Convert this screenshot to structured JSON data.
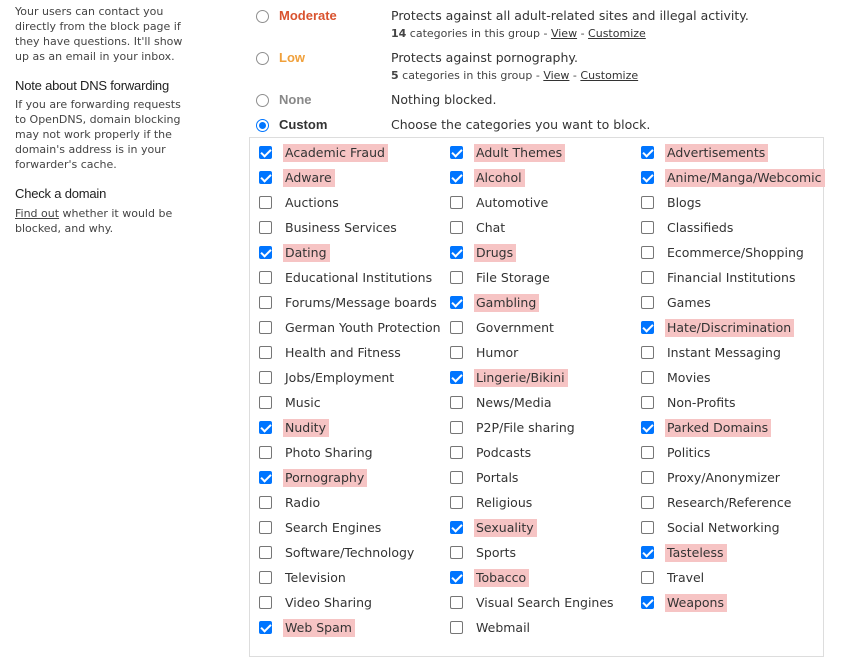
{
  "sidebar": {
    "intro": "Your users can contact you directly from the block page if they have questions. It'll show up as an email in your inbox.",
    "dns_heading": "Note about DNS forwarding",
    "dns_text": "If you are forwarding requests to OpenDNS, domain blocking may not work properly if the domain's address is in your forwarder's cache.",
    "check_heading": "Check a domain",
    "check_link": "Find out",
    "check_text": " whether it would be blocked, and why."
  },
  "levels": [
    {
      "name": "Moderate",
      "color": "#d9532f",
      "desc": "Protects against all adult-related sites and illegal activity.",
      "count": "14",
      "count_text": " categories in this group - ",
      "view": "View",
      "sep": " - ",
      "customize": "Customize",
      "selected": false
    },
    {
      "name": "Low",
      "color": "#f0a03b",
      "desc": "Protects against pornography.",
      "count": "5",
      "count_text": " categories in this group - ",
      "view": "View",
      "sep": " - ",
      "customize": "Customize",
      "selected": false
    },
    {
      "name": "None",
      "color": "#888888",
      "desc": "Nothing blocked.",
      "selected": false
    },
    {
      "name": "Custom",
      "color": "#333333",
      "desc": "Choose the categories you want to block.",
      "selected": true
    }
  ],
  "categories": [
    [
      {
        "label": "Academic Fraud",
        "checked": true
      },
      {
        "label": "Adware",
        "checked": true
      },
      {
        "label": "Auctions",
        "checked": false
      },
      {
        "label": "Business Services",
        "checked": false
      },
      {
        "label": "Dating",
        "checked": true
      },
      {
        "label": "Educational Institutions",
        "checked": false
      },
      {
        "label": "Forums/Message boards",
        "checked": false
      },
      {
        "label": "German Youth Protection",
        "checked": false
      },
      {
        "label": "Health and Fitness",
        "checked": false
      },
      {
        "label": "Jobs/Employment",
        "checked": false
      },
      {
        "label": "Music",
        "checked": false
      },
      {
        "label": "Nudity",
        "checked": true
      },
      {
        "label": "Photo Sharing",
        "checked": false
      },
      {
        "label": "Pornography",
        "checked": true
      },
      {
        "label": "Radio",
        "checked": false
      },
      {
        "label": "Search Engines",
        "checked": false
      },
      {
        "label": "Software/Technology",
        "checked": false
      },
      {
        "label": "Television",
        "checked": false
      },
      {
        "label": "Video Sharing",
        "checked": false
      },
      {
        "label": "Web Spam",
        "checked": true
      }
    ],
    [
      {
        "label": "Adult Themes",
        "checked": true
      },
      {
        "label": "Alcohol",
        "checked": true
      },
      {
        "label": "Automotive",
        "checked": false
      },
      {
        "label": "Chat",
        "checked": false
      },
      {
        "label": "Drugs",
        "checked": true
      },
      {
        "label": "File Storage",
        "checked": false
      },
      {
        "label": "Gambling",
        "checked": true
      },
      {
        "label": "Government",
        "checked": false
      },
      {
        "label": "Humor",
        "checked": false
      },
      {
        "label": "Lingerie/Bikini",
        "checked": true
      },
      {
        "label": "News/Media",
        "checked": false
      },
      {
        "label": "P2P/File sharing",
        "checked": false
      },
      {
        "label": "Podcasts",
        "checked": false
      },
      {
        "label": "Portals",
        "checked": false
      },
      {
        "label": "Religious",
        "checked": false
      },
      {
        "label": "Sexuality",
        "checked": true
      },
      {
        "label": "Sports",
        "checked": false
      },
      {
        "label": "Tobacco",
        "checked": true
      },
      {
        "label": "Visual Search Engines",
        "checked": false
      },
      {
        "label": "Webmail",
        "checked": false
      }
    ],
    [
      {
        "label": "Advertisements",
        "checked": true
      },
      {
        "label": "Anime/Manga/Webcomic",
        "checked": true
      },
      {
        "label": "Blogs",
        "checked": false
      },
      {
        "label": "Classifieds",
        "checked": false
      },
      {
        "label": "Ecommerce/Shopping",
        "checked": false
      },
      {
        "label": "Financial Institutions",
        "checked": false
      },
      {
        "label": "Games",
        "checked": false
      },
      {
        "label": "Hate/Discrimination",
        "checked": true
      },
      {
        "label": "Instant Messaging",
        "checked": false
      },
      {
        "label": "Movies",
        "checked": false
      },
      {
        "label": "Non-Profits",
        "checked": false
      },
      {
        "label": "Parked Domains",
        "checked": true
      },
      {
        "label": "Politics",
        "checked": false
      },
      {
        "label": "Proxy/Anonymizer",
        "checked": false
      },
      {
        "label": "Research/Reference",
        "checked": false
      },
      {
        "label": "Social Networking",
        "checked": false
      },
      {
        "label": "Tasteless",
        "checked": true
      },
      {
        "label": "Travel",
        "checked": false
      },
      {
        "label": "Weapons",
        "checked": true
      }
    ]
  ]
}
